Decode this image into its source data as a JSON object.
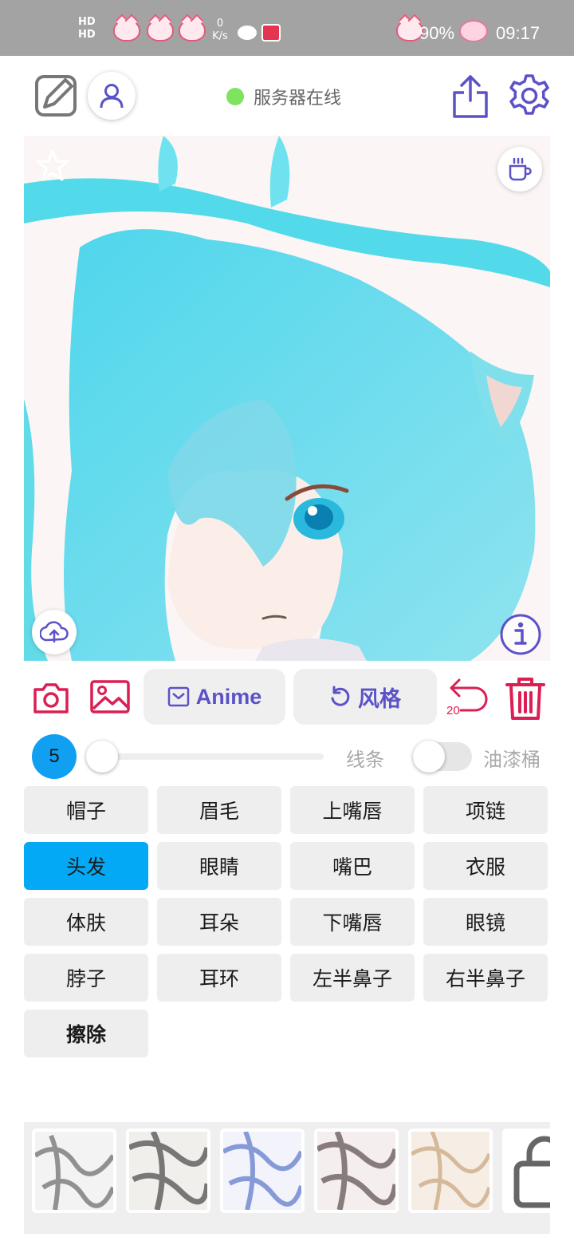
{
  "status_bar": {
    "hd_line1": "HD",
    "hd_line2": "HD",
    "speed_value": "0",
    "speed_unit": "K/s",
    "battery": "90%",
    "time": "09:17"
  },
  "toolbar": {
    "server_status": "服务器在线",
    "status_color": "#7ee35f"
  },
  "actions": {
    "anime_label": "Anime",
    "style_label": "风格",
    "undo_count": "20"
  },
  "brush": {
    "size": "5",
    "lines_label": "线条",
    "bucket_label": "油漆桶",
    "bucket_on": false
  },
  "parts": [
    {
      "label": "帽子",
      "active": false
    },
    {
      "label": "眉毛",
      "active": false
    },
    {
      "label": "上嘴唇",
      "active": false
    },
    {
      "label": "项链",
      "active": false
    },
    {
      "label": "头发",
      "active": true
    },
    {
      "label": "眼睛",
      "active": false
    },
    {
      "label": "嘴巴",
      "active": false
    },
    {
      "label": "衣服",
      "active": false
    },
    {
      "label": "体肤",
      "active": false
    },
    {
      "label": "耳朵",
      "active": false
    },
    {
      "label": "下嘴唇",
      "active": false
    },
    {
      "label": "眼镜",
      "active": false
    },
    {
      "label": "脖子",
      "active": false
    },
    {
      "label": "耳环",
      "active": false
    },
    {
      "label": "左半鼻子",
      "active": false
    },
    {
      "label": "右半鼻子",
      "active": false
    }
  ],
  "erase_label": "擦除",
  "colors": {
    "accent": "#5b52c7",
    "danger": "#dc1f52",
    "selected_part": "#03a9f4",
    "size_badge": "#119ff1"
  }
}
